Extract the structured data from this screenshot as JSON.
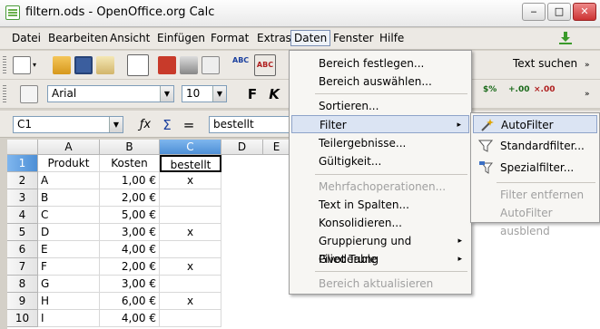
{
  "window": {
    "title": "filtern.ods - OpenOffice.org Calc",
    "buttons": [
      "‒",
      "□",
      "✕"
    ]
  },
  "menubar": {
    "items": [
      "Datei",
      "Bearbeiten",
      "Ansicht",
      "Einfügen",
      "Format",
      "Extras",
      "Daten",
      "Fenster",
      "Hilfe"
    ]
  },
  "toolbar": {
    "search_text": "Text suchen",
    "font_name": "Arial",
    "font_size": "10",
    "bold": "F",
    "italic": "K"
  },
  "formula_bar": {
    "cell_ref": "C1",
    "content": "bestellt",
    "fx": "ƒx",
    "sigma": "Σ",
    "equals": "="
  },
  "sheet": {
    "columns": [
      "A",
      "B",
      "C",
      "D",
      "E"
    ],
    "rows": [
      "1",
      "2",
      "3",
      "4",
      "5",
      "6",
      "7",
      "8",
      "9",
      "10"
    ],
    "data": [
      [
        "Produkt",
        "Kosten",
        "bestellt"
      ],
      [
        "A",
        "1,00 €",
        "x"
      ],
      [
        "B",
        "2,00 €",
        ""
      ],
      [
        "C",
        "5,00 €",
        ""
      ],
      [
        "D",
        "3,00 €",
        "x"
      ],
      [
        "E",
        "4,00 €",
        ""
      ],
      [
        "F",
        "2,00 €",
        "x"
      ],
      [
        "G",
        "3,00 €",
        ""
      ],
      [
        "H",
        "6,00 €",
        "x"
      ],
      [
        "I",
        "4,00 €",
        ""
      ]
    ]
  },
  "daten_menu": [
    {
      "label": "Bereich festlegen...",
      "sub": false,
      "disabled": false
    },
    {
      "label": "Bereich auswählen...",
      "sub": false,
      "disabled": false
    },
    {
      "label": "Sortieren...",
      "sub": false,
      "disabled": false
    },
    {
      "label": "Filter",
      "sub": true,
      "disabled": false
    },
    {
      "label": "Teilergebnisse...",
      "sub": false,
      "disabled": false
    },
    {
      "label": "Gültigkeit...",
      "sub": false,
      "disabled": false
    },
    {
      "label": "Mehrfachoperationen...",
      "sub": false,
      "disabled": true
    },
    {
      "label": "Text in Spalten...",
      "sub": false,
      "disabled": false
    },
    {
      "label": "Konsolidieren...",
      "sub": false,
      "disabled": false
    },
    {
      "label": "Gruppierung und Gliederung",
      "sub": true,
      "disabled": false
    },
    {
      "label": "Pivot Table",
      "sub": true,
      "disabled": false
    },
    {
      "label": "Bereich aktualisieren",
      "sub": false,
      "disabled": true
    }
  ],
  "filter_submenu": [
    {
      "label": "AutoFilter",
      "disabled": false
    },
    {
      "label": "Standardfilter...",
      "disabled": false
    },
    {
      "label": "Spezialfilter...",
      "disabled": false
    },
    {
      "label": "Filter entfernen",
      "disabled": true
    },
    {
      "label": "AutoFilter ausblend",
      "disabled": true
    }
  ],
  "submenu_arrow": "▸",
  "colors": {
    "accent": "#4d8fd6",
    "menu_highlight": "#dbe4f3",
    "disabled": "#a0a0a0"
  }
}
